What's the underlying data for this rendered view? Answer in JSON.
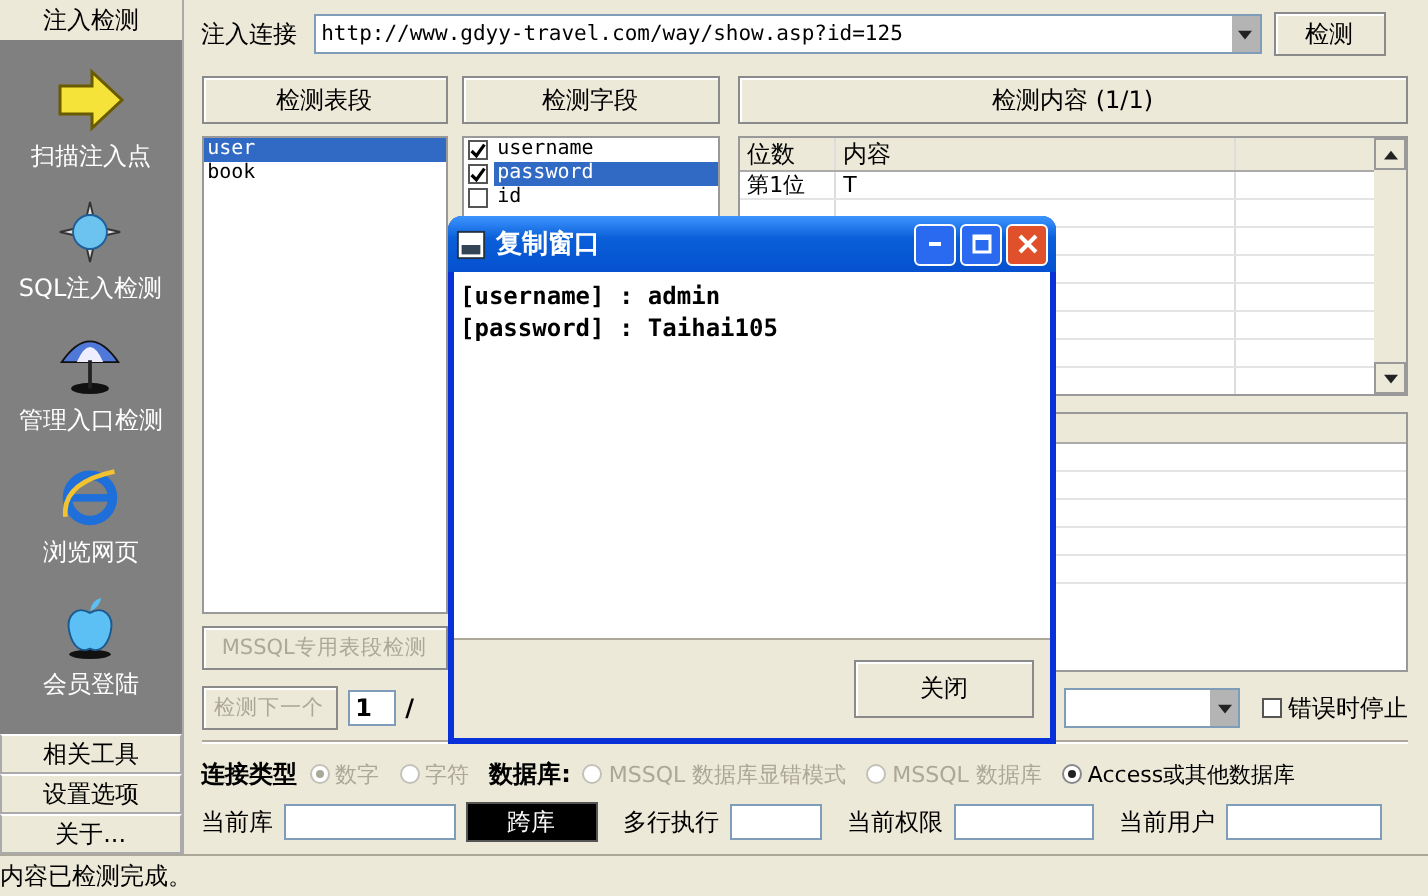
{
  "sidebar": {
    "tab": "注入检测",
    "items": [
      {
        "label": "扫描注入点"
      },
      {
        "label": "SQL注入检测"
      },
      {
        "label": "管理入口检测"
      },
      {
        "label": "浏览网页"
      },
      {
        "label": "会员登陆"
      }
    ],
    "buttons": [
      "相关工具",
      "设置选项",
      "关于..."
    ]
  },
  "url_bar": {
    "label": "注入连接",
    "value": "http://www.gdyy-travel.com/way/show.asp?id=125",
    "button": "检测"
  },
  "tables_panel": {
    "header": "检测表段",
    "items": [
      {
        "name": "user",
        "selected": true
      },
      {
        "name": "book",
        "selected": false
      }
    ],
    "button": {
      "label": "MSSQL专用表段检测",
      "disabled": true
    }
  },
  "fields_panel": {
    "header": "检测字段",
    "items": [
      {
        "name": "username",
        "checked": true,
        "selected": false
      },
      {
        "name": "password",
        "checked": true,
        "selected": true
      },
      {
        "name": "id",
        "checked": false,
        "selected": false
      }
    ]
  },
  "content_panel": {
    "header": "检测内容 (1/1)",
    "columns": [
      "位数",
      "内容"
    ],
    "rows": [
      {
        "position": "第1位",
        "content": "T"
      }
    ]
  },
  "next_row": {
    "button": {
      "label": "检测下一个",
      "disabled": true
    },
    "page_value": "1",
    "separator": "/",
    "stop_on_error": {
      "label": "错误时停止",
      "checked": false
    }
  },
  "connection_type": {
    "label": "连接类型",
    "options": [
      {
        "label": "数字",
        "selected": true,
        "disabled": true
      },
      {
        "label": "字符",
        "selected": false,
        "disabled": true
      }
    ]
  },
  "database": {
    "label": "数据库:",
    "options": [
      {
        "label": "MSSQL 数据库显错模式",
        "selected": false,
        "disabled": true
      },
      {
        "label": "MSSQL 数据库",
        "selected": false,
        "disabled": true
      },
      {
        "label": "Access或其他数据库",
        "selected": true,
        "disabled": false
      }
    ]
  },
  "info_row": {
    "current_db_label": "当前库",
    "cross_db_button": "跨库",
    "fields": [
      {
        "label": "多行执行"
      },
      {
        "label": "当前权限"
      },
      {
        "label": "当前用户"
      }
    ]
  },
  "dialog": {
    "title": "复制窗口",
    "lines": [
      "[username] : admin",
      "[password] : Taihai105"
    ],
    "button": "关闭"
  },
  "status_bar": "内容已检测完成。"
}
